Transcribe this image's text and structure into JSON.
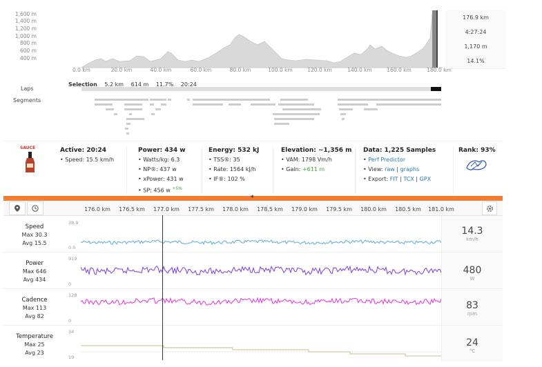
{
  "elevation": {
    "y_ticks": [
      "1,600 m",
      "1,400 m",
      "1,200 m",
      "1,000 m",
      "800 m",
      "600 m",
      "400 m"
    ],
    "x_ticks": [
      "0.0 km",
      "20.0 km",
      "40.0 km",
      "60.0 km",
      "80.0 km",
      "100.0 km",
      "120.0 km",
      "140.0 km",
      "160.0 km",
      "180.0 km"
    ],
    "stats": [
      "176.9 km",
      "4:27:24",
      "1,170 m",
      "14.1%"
    ]
  },
  "selection": {
    "label": "Selection",
    "values": [
      "5.2 km",
      "614 m",
      "11.7%",
      "20:24"
    ]
  },
  "rows_labels": {
    "laps": "Laps",
    "segments": "Segments"
  },
  "summary": {
    "logo_text": "SAUCE",
    "active": {
      "title": "Active: 20:24",
      "speed": "• Speed: 15.5 km/h"
    },
    "power": {
      "title": "Power: 434 w",
      "items": [
        "• Watts/kg: 6.3",
        "• NP®: 437 w",
        "• xPower: 431 w",
        "• SP: 456 w"
      ],
      "sp_delta": "+5%"
    },
    "energy": {
      "title": "Energy: 532 kJ",
      "items": [
        "• TSS®: 35",
        "• Rate: 1564 kJ/h",
        "• IF®: 102 %"
      ]
    },
    "elevation": {
      "title": "Elevation: ~1,356 m",
      "vam": "• VAM: 1798 Vm/h",
      "gain_label": "• Gain:",
      "gain_value": "+611 m"
    },
    "data": {
      "title": "Data: 1,225 Samples",
      "perf": "Perf Predictor",
      "view_label": "• View:",
      "view_raw": "raw",
      "view_graphs": "graphs",
      "export_label": "• Export:",
      "export_fit": "FIT",
      "export_tcx": "TCX",
      "export_gpx": "GPX"
    },
    "rank": {
      "title": "Rank: 93%"
    }
  },
  "divider_mark": "*",
  "timeline": {
    "ticks": [
      "176.0 km",
      "176.5 km",
      "177.0 km",
      "177.5 km",
      "178.0 km",
      "178.5 km",
      "179.0 km",
      "179.5 km",
      "180.0 km",
      "180.5 km",
      "181.0 km"
    ],
    "icons": [
      "location-pin-icon",
      "clock-icon",
      "gear-icon"
    ]
  },
  "streams": [
    {
      "name": "Speed",
      "max": "Max 30.3",
      "avg": "Avg 15.5",
      "top": "38.9",
      "bottom": "0.0",
      "value": "14.3",
      "unit": "km/h",
      "color": "#5aaedb"
    },
    {
      "name": "Power",
      "max": "Max 646",
      "avg": "Avg 434",
      "top": "919",
      "bottom": "0",
      "value": "480",
      "unit": "W",
      "color": "#7a3fe0"
    },
    {
      "name": "Cadence",
      "max": "Max 113",
      "avg": "Avg 82",
      "top": "128",
      "bottom": "0",
      "value": "83",
      "unit": "rpm",
      "color": "#e832e0"
    },
    {
      "name": "Temperature",
      "max": "Max 25",
      "avg": "Avg 23",
      "top": "34",
      "bottom": "19",
      "value": "24",
      "unit": "°C",
      "color": "#c8bd8a"
    }
  ]
}
